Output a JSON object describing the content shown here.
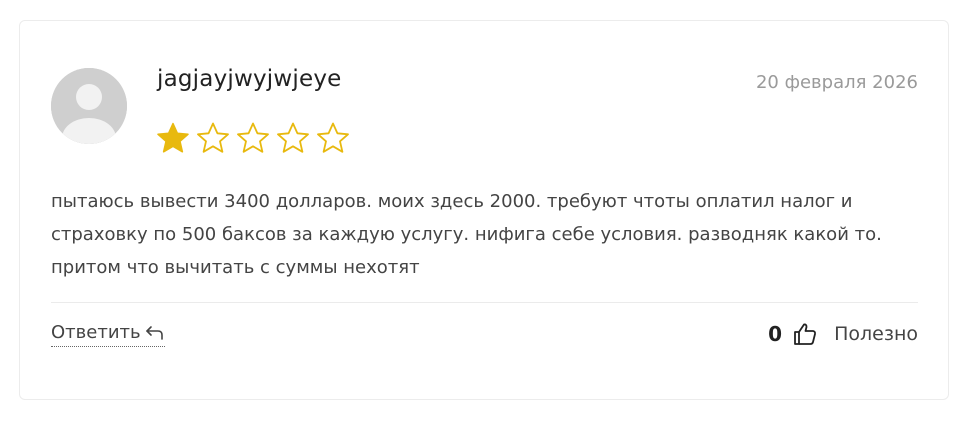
{
  "review": {
    "author": "jagjayjwyjwjeye",
    "date": "20 февраля 2026",
    "rating": 1,
    "max_rating": 5,
    "text": "пытаюсь вывести 3400 долларов. моих здесь 2000. требуют чтоты оплатил налог и страховку по 500 баксов за каждую услугу. нифига себе условия. разводняк какой то. притом что вычитать с суммы нехотят"
  },
  "actions": {
    "reply_label": "Ответить",
    "useful_count": "0",
    "useful_label": "Полезно"
  },
  "icons": {
    "avatar": "user-avatar-placeholder",
    "star_filled": "star-filled-icon",
    "star_empty": "star-outline-icon",
    "reply": "reply-arrow-icon",
    "thumb": "thumbs-up-icon"
  },
  "colors": {
    "star": "#e8b90f",
    "date": "#9a9a9a",
    "avatar_bg": "#cfcfcf"
  }
}
